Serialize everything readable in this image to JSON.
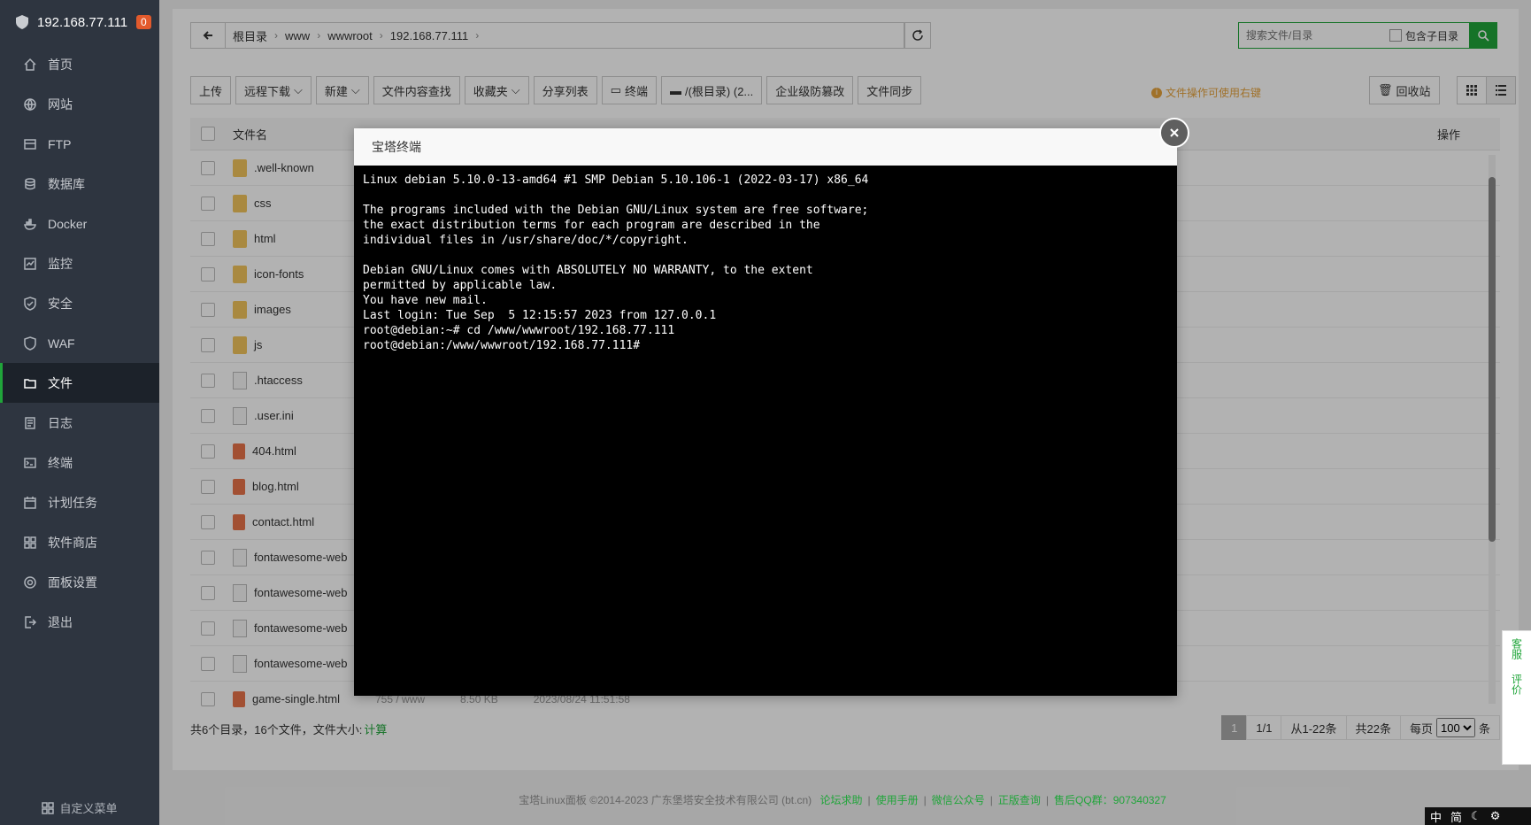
{
  "sidebar": {
    "host": "192.168.77.111",
    "badge": "0",
    "items": [
      {
        "label": "首页",
        "icon": "home-icon"
      },
      {
        "label": "网站",
        "icon": "globe-icon"
      },
      {
        "label": "FTP",
        "icon": "ftp-icon"
      },
      {
        "label": "数据库",
        "icon": "database-icon"
      },
      {
        "label": "Docker",
        "icon": "docker-icon"
      },
      {
        "label": "监控",
        "icon": "monitor-icon"
      },
      {
        "label": "安全",
        "icon": "shield-icon"
      },
      {
        "label": "WAF",
        "icon": "waf-icon"
      },
      {
        "label": "文件",
        "icon": "folder-icon"
      },
      {
        "label": "日志",
        "icon": "log-icon"
      },
      {
        "label": "终端",
        "icon": "terminal-icon"
      },
      {
        "label": "计划任务",
        "icon": "calendar-icon"
      },
      {
        "label": "软件商店",
        "icon": "apps-icon"
      },
      {
        "label": "面板设置",
        "icon": "gear-icon"
      },
      {
        "label": "退出",
        "icon": "logout-icon"
      }
    ],
    "active_index": 8,
    "custom_menu": "自定义菜单"
  },
  "path": {
    "crumbs": [
      "根目录",
      "www",
      "wwwroot",
      "192.168.77.111"
    ]
  },
  "search": {
    "placeholder": "搜索文件/目录",
    "include_sub": "包含子目录"
  },
  "toolbar": {
    "upload": "上传",
    "remote_download": "远程下载",
    "new": "新建",
    "content_search": "文件内容查找",
    "favorites": "收藏夹",
    "share_list": "分享列表",
    "terminal": "终端",
    "disk": "/(根目录) (2...",
    "tamper": "企业级防篡改",
    "sync": "文件同步",
    "tip": "文件操作可使用右键",
    "recycle": "回收站"
  },
  "table": {
    "col_name": "文件名",
    "col_op": "操作",
    "rows": [
      {
        "name": ".well-known",
        "type": "folder"
      },
      {
        "name": "css",
        "type": "folder"
      },
      {
        "name": "html",
        "type": "folder"
      },
      {
        "name": "icon-fonts",
        "type": "folder"
      },
      {
        "name": "images",
        "type": "folder"
      },
      {
        "name": "js",
        "type": "folder"
      },
      {
        "name": ".htaccess",
        "type": "file"
      },
      {
        "name": ".user.ini",
        "type": "file"
      },
      {
        "name": "404.html",
        "type": "html"
      },
      {
        "name": "blog.html",
        "type": "html"
      },
      {
        "name": "contact.html",
        "type": "html"
      },
      {
        "name": "fontawesome-web",
        "type": "file"
      },
      {
        "name": "fontawesome-web",
        "type": "file"
      },
      {
        "name": "fontawesome-web",
        "type": "file"
      },
      {
        "name": "fontawesome-web",
        "type": "file"
      },
      {
        "name": "game-single.html",
        "type": "html",
        "perm": "755 / www",
        "size": "8.50 KB",
        "mtime": "2023/08/24 11:51:58"
      }
    ]
  },
  "summary": {
    "text": "共6个目录，16个文件，文件大小:",
    "calc": "计算"
  },
  "pager": {
    "current": "1",
    "total_pages": "1/1",
    "range": "从1-22条",
    "total": "共22条",
    "per_page_label": "每页",
    "per_page": "100",
    "unit": "条"
  },
  "footer": {
    "copyright": "宝塔Linux面板 ©2014-2023 广东堡塔安全技术有限公司 (bt.cn)",
    "links": [
      "论坛求助",
      "使用手册",
      "微信公众号",
      "正版查询",
      "售后QQ群：907340327"
    ]
  },
  "side_help": {
    "service": "客服",
    "review": "评价"
  },
  "lang_bar": [
    "中",
    "简"
  ],
  "modal": {
    "title": "宝塔终端",
    "terminal_text": "Linux debian 5.10.0-13-amd64 #1 SMP Debian 5.10.106-1 (2022-03-17) x86_64\n\nThe programs included with the Debian GNU/Linux system are free software;\nthe exact distribution terms for each program are described in the\nindividual files in /usr/share/doc/*/copyright.\n\nDebian GNU/Linux comes with ABSOLUTELY NO WARRANTY, to the extent\npermitted by applicable law.\nYou have new mail.\nLast login: Tue Sep  5 12:15:57 2023 from 127.0.0.1\nroot@debian:~# cd /www/wwwroot/192.168.77.111\nroot@debian:/www/wwwroot/192.168.77.111# "
  },
  "colors": {
    "accent": "#20a53a",
    "sidebar_bg": "#2e3540",
    "warning": "#e6a23c",
    "badge": "#e25a2c"
  }
}
